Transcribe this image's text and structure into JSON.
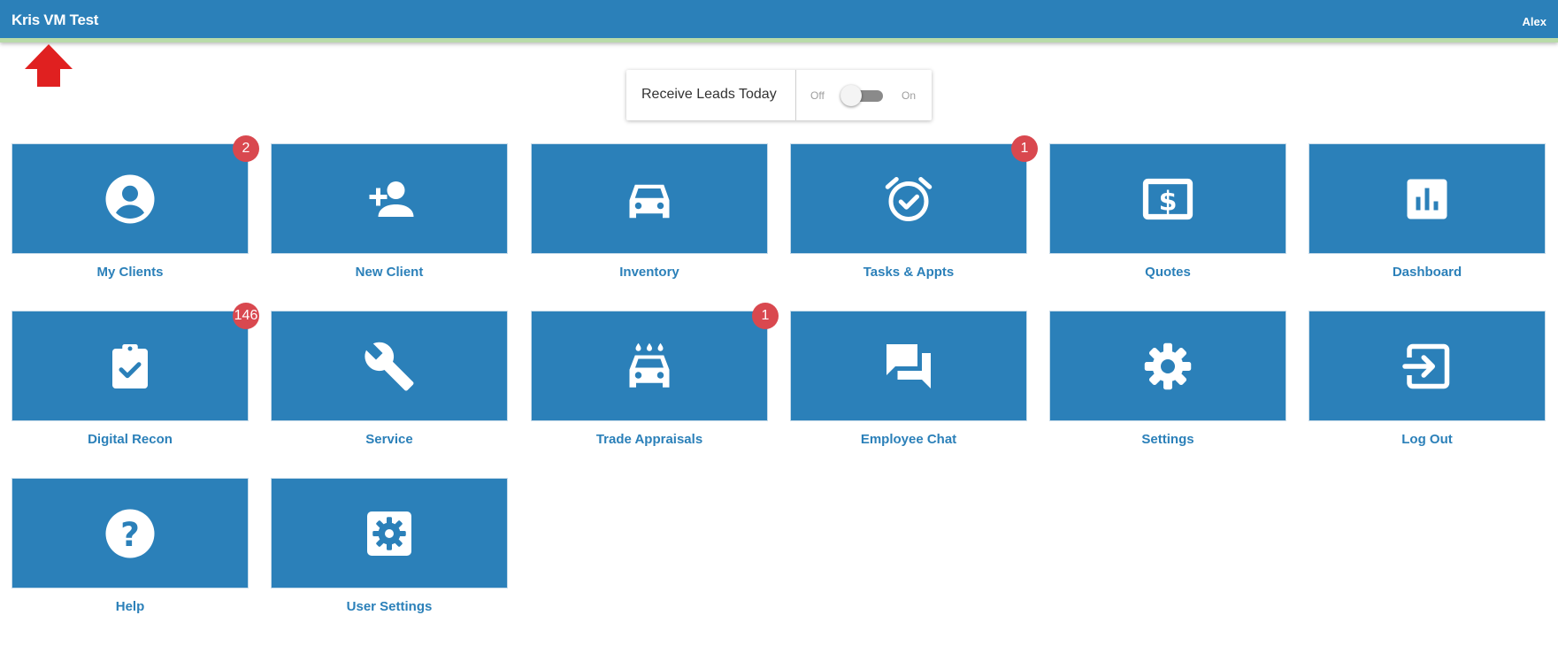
{
  "header": {
    "app_title": "Kris VM Test",
    "user_name": "Alex"
  },
  "leads_toggle": {
    "label": "Receive Leads Today",
    "off_label": "Off",
    "on_label": "On",
    "state": "off"
  },
  "tiles": [
    {
      "label": "My Clients",
      "icon": "account-circle-icon",
      "badge": "2"
    },
    {
      "label": "New Client",
      "icon": "person-add-icon",
      "badge": ""
    },
    {
      "label": "Inventory",
      "icon": "car-icon",
      "badge": ""
    },
    {
      "label": "Tasks & Appts",
      "icon": "alarm-check-icon",
      "badge": "1"
    },
    {
      "label": "Quotes",
      "icon": "dollar-quote-icon",
      "badge": ""
    },
    {
      "label": "Dashboard",
      "icon": "bar-chart-icon",
      "badge": ""
    },
    {
      "label": "Digital Recon",
      "icon": "clipboard-check-icon",
      "badge": "146"
    },
    {
      "label": "Service",
      "icon": "wrench-icon",
      "badge": ""
    },
    {
      "label": "Trade Appraisals",
      "icon": "car-wash-icon",
      "badge": "1"
    },
    {
      "label": "Employee Chat",
      "icon": "chat-icon",
      "badge": ""
    },
    {
      "label": "Settings",
      "icon": "gear-icon",
      "badge": ""
    },
    {
      "label": "Log Out",
      "icon": "logout-icon",
      "badge": ""
    },
    {
      "label": "Help",
      "icon": "help-icon",
      "badge": ""
    },
    {
      "label": "User Settings",
      "icon": "user-settings-icon",
      "badge": ""
    }
  ],
  "colors": {
    "primary": "#2b80b9",
    "badge": "#d9484f",
    "header_accent": "#b9dba9",
    "arrow": "#e02020"
  }
}
